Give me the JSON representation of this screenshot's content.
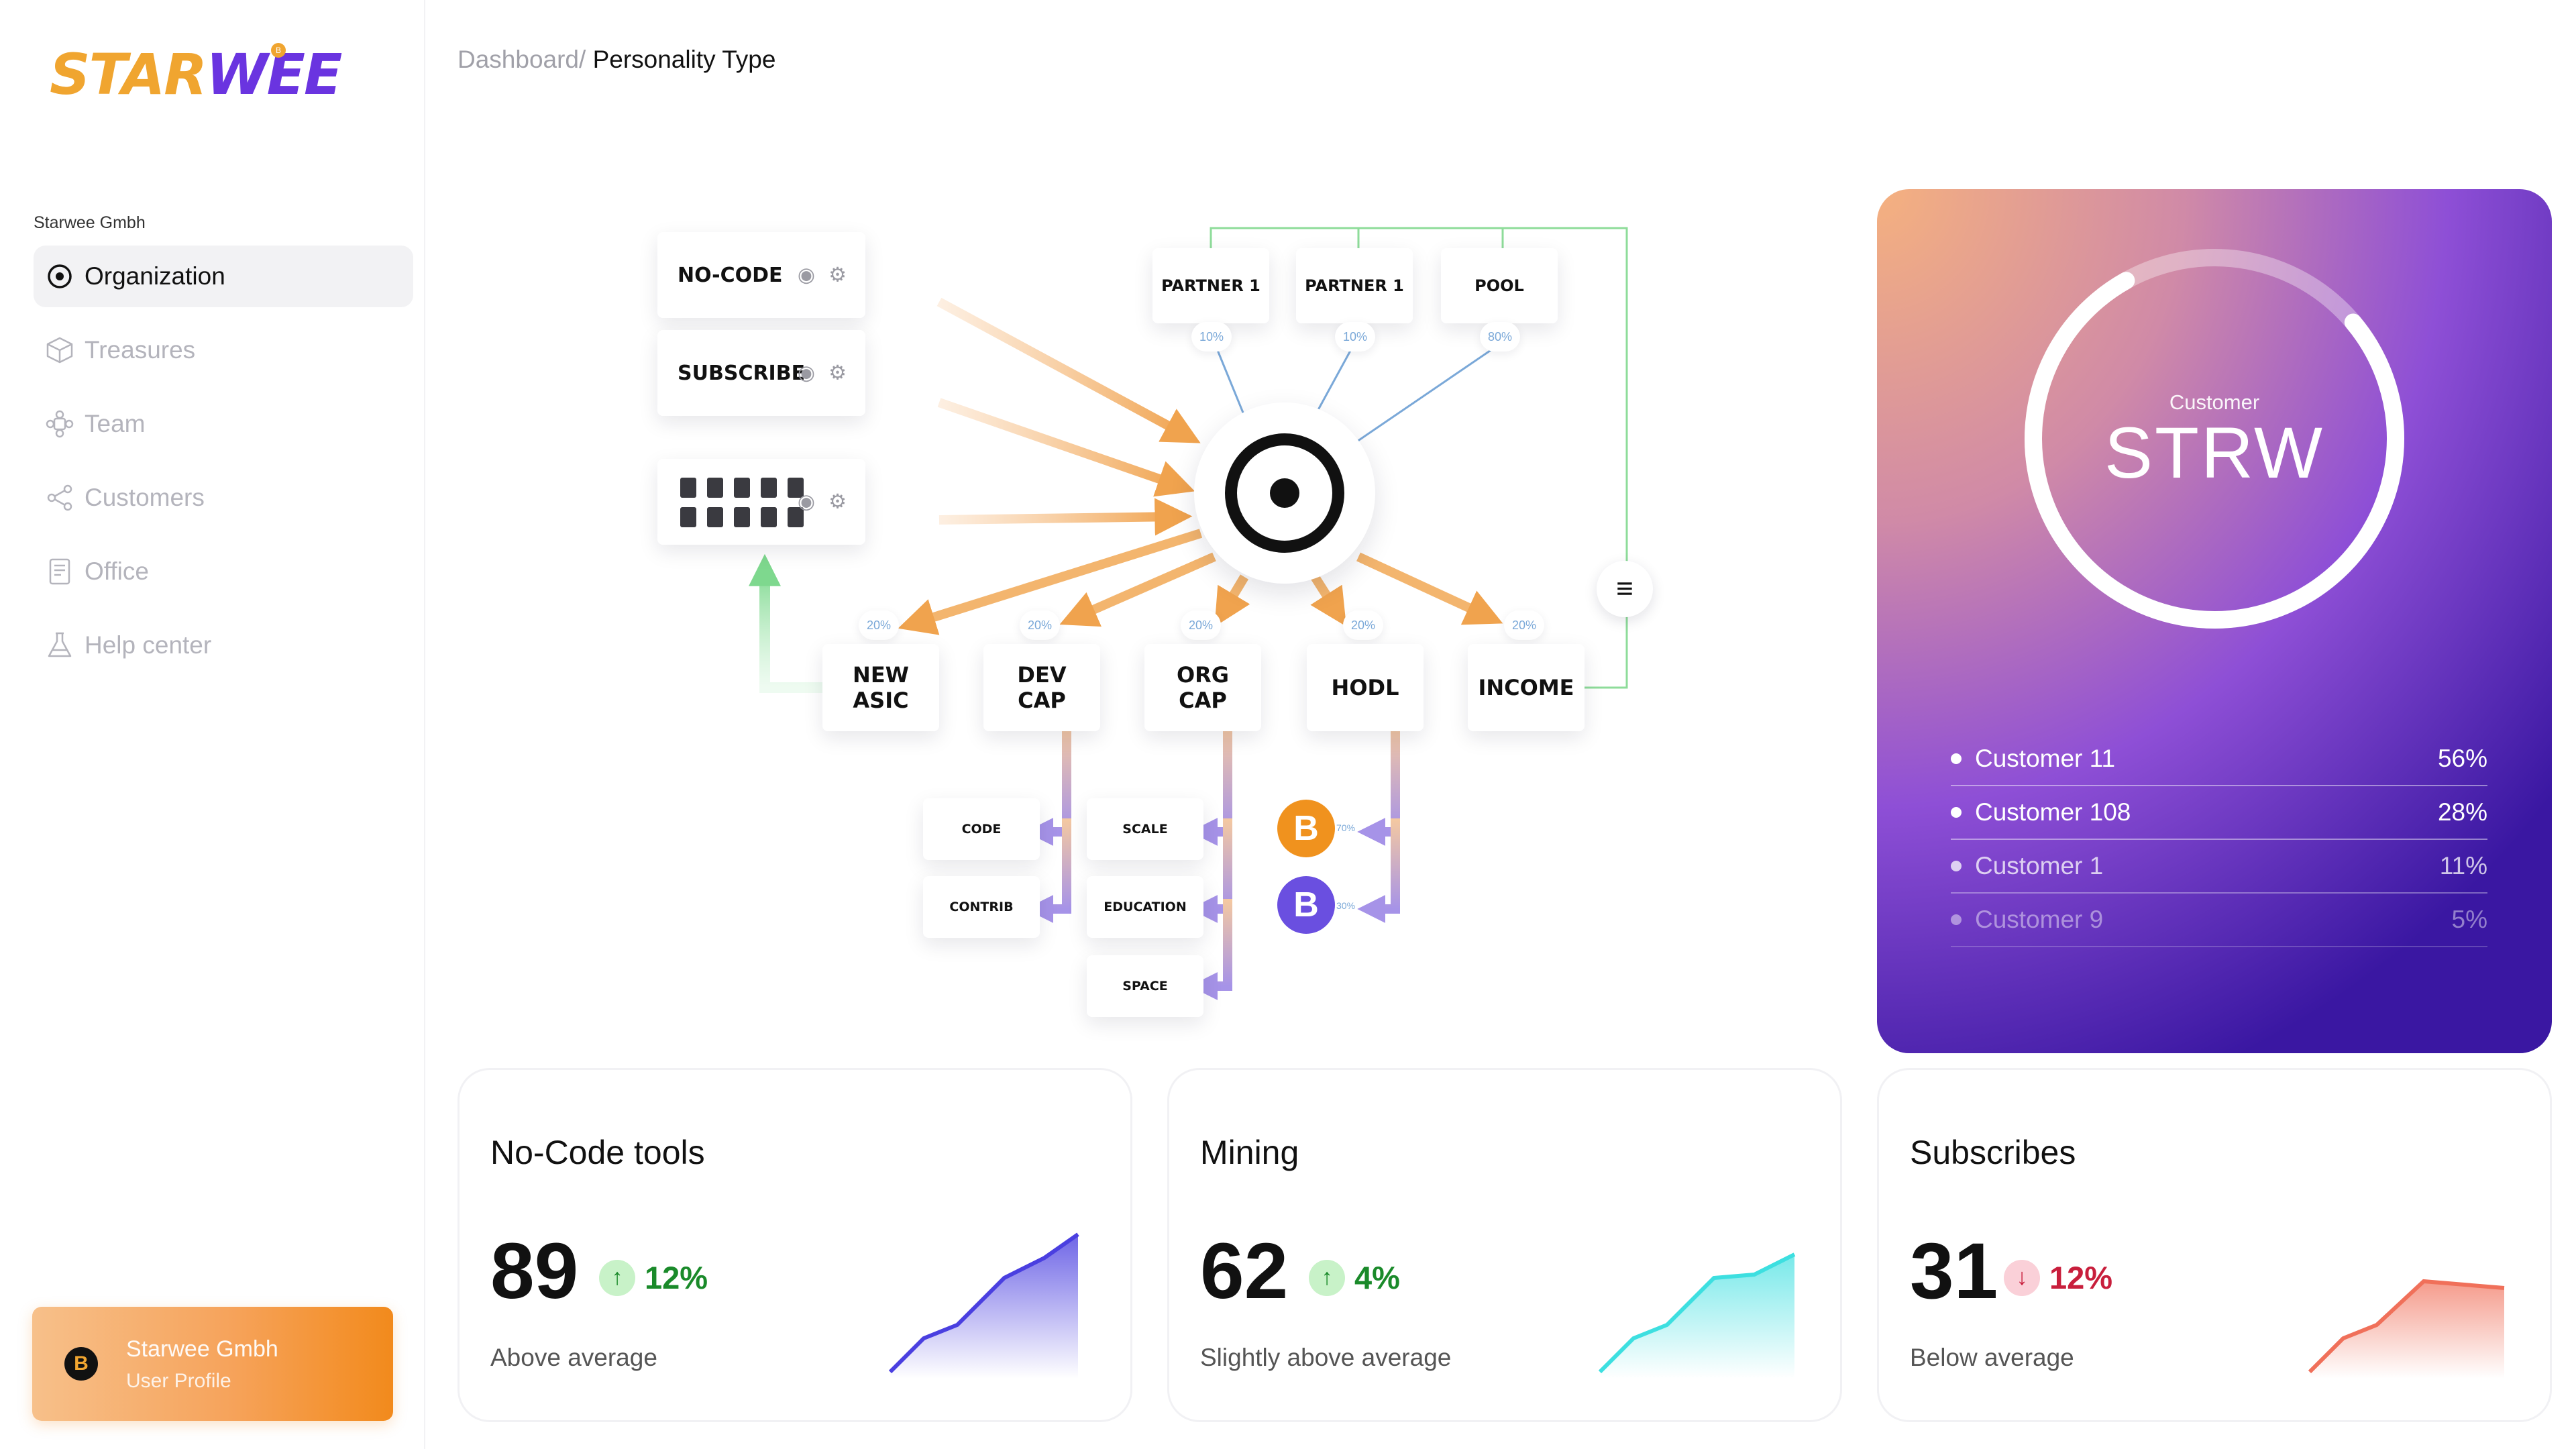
{
  "brand": {
    "logo_part1": "STAR",
    "logo_part2": "WEE",
    "logo_mark": "B",
    "org_caption": "Starwee Gmbh"
  },
  "sidebar": {
    "items": [
      {
        "label": "Organization",
        "icon": "target-icon",
        "active": true
      },
      {
        "label": "Treasures",
        "icon": "box-icon"
      },
      {
        "label": "Team",
        "icon": "team-icon"
      },
      {
        "label": "Customers",
        "icon": "share-icon"
      },
      {
        "label": "Office",
        "icon": "document-icon"
      },
      {
        "label": "Help center",
        "icon": "flask-icon"
      }
    ],
    "profile": {
      "name": "Starwee Gmbh",
      "role": "User Profile",
      "coin": "B"
    }
  },
  "breadcrumb": {
    "root": "Dashboard/",
    "current": " Personality Type"
  },
  "diagram": {
    "sources": [
      {
        "label": "NO-CODE"
      },
      {
        "label": "SUBSCRIBE"
      },
      {
        "label": ""
      }
    ],
    "partners": [
      {
        "label": "PARTNER 1",
        "pct": "10%"
      },
      {
        "label": "PARTNER 1",
        "pct": "10%"
      },
      {
        "label": "POOL",
        "pct": "80%"
      }
    ],
    "outputs": [
      {
        "line1": "NEW",
        "line2": "ASIC",
        "pct": "20%"
      },
      {
        "line1": "DEV",
        "line2": "CAP",
        "pct": "20%"
      },
      {
        "line1": "ORG",
        "line2": "CAP",
        "pct": "20%"
      },
      {
        "line1": "HODL",
        "line2": "",
        "pct": "20%"
      },
      {
        "line1": "INCOME",
        "line2": "",
        "pct": "20%"
      }
    ],
    "subs": {
      "code": "CODE",
      "contrib": "CONTRIB",
      "scale": "SCALE",
      "education": "EDUCATION",
      "space": "SPACE"
    },
    "coins": [
      {
        "symbol": "B",
        "pct": "70%"
      },
      {
        "symbol": "B",
        "pct": "30%"
      }
    ],
    "equal_button": "≡"
  },
  "customer_card": {
    "caption": "Customer",
    "title": "STRW",
    "ring_fraction": 0.78,
    "rows": [
      {
        "label": "Customer 11",
        "value": "56%"
      },
      {
        "label": "Customer 108",
        "value": "28%"
      },
      {
        "label": "Customer 1",
        "value": "11%"
      },
      {
        "label": "Customer 9",
        "value": "5%"
      }
    ]
  },
  "stats": [
    {
      "title": "No-Code tools",
      "value": "89",
      "delta": "12%",
      "arrow": "↑",
      "direction": "up",
      "subtitle": "Above average",
      "color": "#4A3FE0"
    },
    {
      "title": "Mining",
      "value": "62",
      "delta": "4%",
      "arrow": "↑",
      "direction": "up",
      "subtitle": "Slightly above average",
      "color": "#3DDFE0"
    },
    {
      "title": "Subscribes",
      "value": "31",
      "delta": "12%",
      "arrow": "↓",
      "direction": "down",
      "subtitle": "Below average",
      "color": "#F0705A"
    }
  ]
}
